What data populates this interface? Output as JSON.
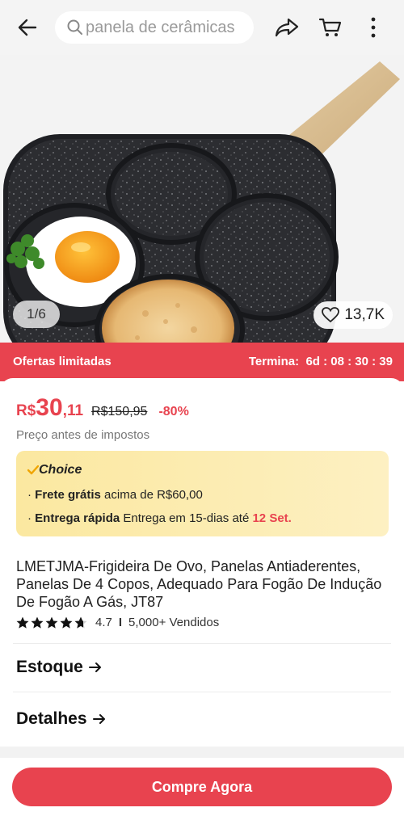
{
  "header": {
    "search_placeholder": "panela de cerâmicas",
    "icons": [
      "back-arrow-icon",
      "search-icon",
      "share-icon",
      "cart-icon",
      "more-vertical-icon"
    ]
  },
  "gallery": {
    "counter": "1/6",
    "likes": "13,7K"
  },
  "offer": {
    "label": "Ofertas limitadas",
    "ends_label": "Termina:",
    "countdown": "6d : 08 : 30 : 39"
  },
  "price": {
    "currency": "R$",
    "integer": "30",
    "cents": ",11",
    "original": "R$150,95",
    "discount": "-80%",
    "note": "Preço antes de impostos"
  },
  "choice": {
    "title": "Choice",
    "line1_bullet": "·",
    "line1_bold": "Frete grátis",
    "line1_text": " acima de R$60,00",
    "line2_bullet": "·",
    "line2_bold": "Entrega rápida",
    "line2_text": " Entrega em 15-dias até ",
    "line2_date": "12 Set."
  },
  "product": {
    "title": "LMETJMA-Frigideira De Ovo, Panelas Antiaderentes, Panelas De 4 Copos, Adequado Para Fogão De Indução De Fogão A Gás, JT87",
    "rating": "4.7",
    "stars": 4.7,
    "separator": "I",
    "sold": "5,000+ Vendidos"
  },
  "sections": {
    "stock": "Estoque",
    "details": "Detalhes"
  },
  "cta": {
    "buy_now": "Compre Agora"
  },
  "colors": {
    "accent": "#e8434f",
    "choice_bg": "#fbe8a0"
  }
}
